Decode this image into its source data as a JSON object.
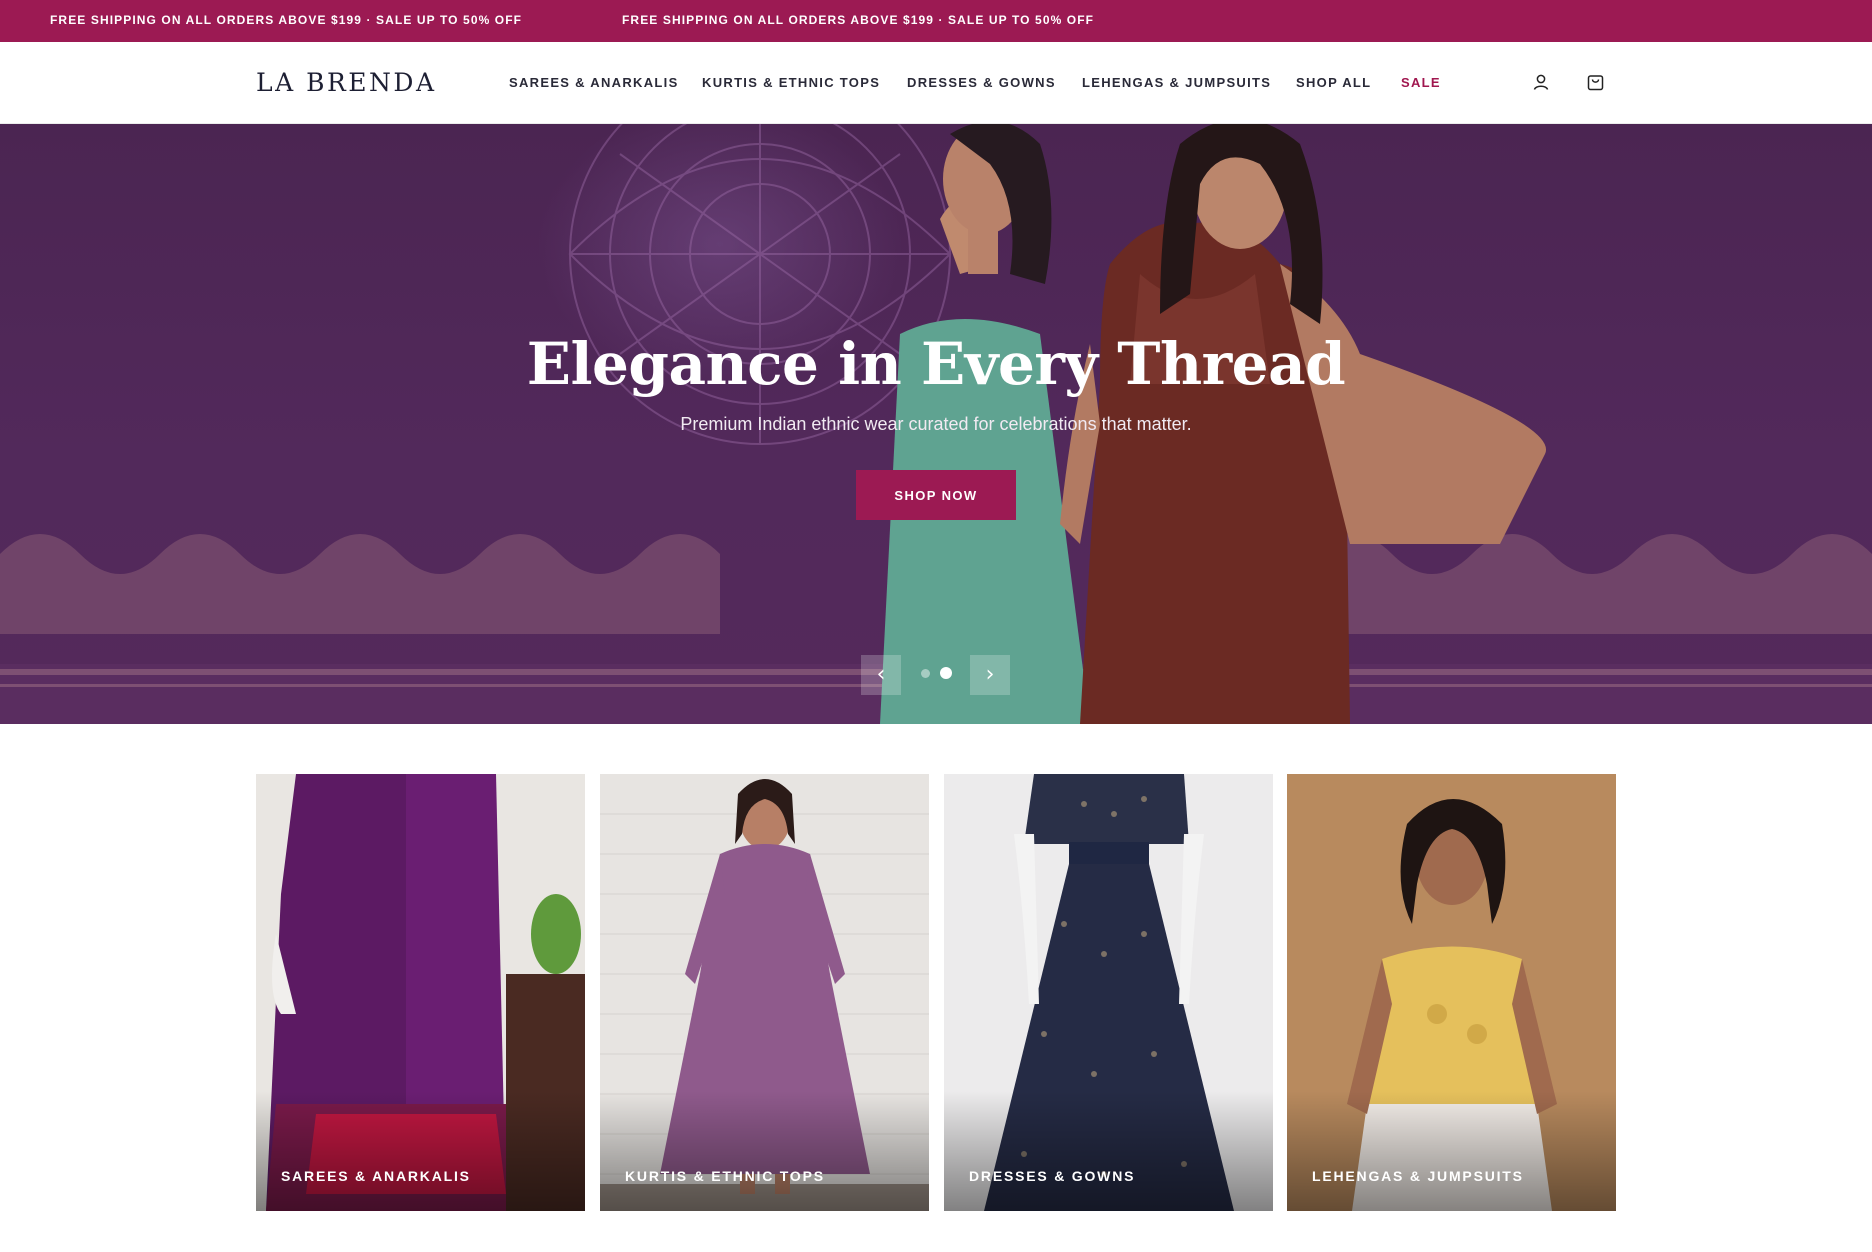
{
  "announcement": {
    "messages": [
      "FREE SHIPPING ON ALL ORDERS ABOVE $199 · SALE UP TO 50% OFF",
      "FREE SHIPPING ON ALL ORDERS ABOVE $199 · SALE UP TO 50% OFF"
    ]
  },
  "header": {
    "logo": "LA BRENDA",
    "nav": [
      "SAREES & ANARKALIS",
      "KURTIS & ETHNIC TOPS",
      "DRESSES & GOWNS",
      "LEHENGAS & JUMPSUITS",
      "SHOP ALL",
      "SALE"
    ],
    "icons": [
      "account-icon",
      "cart-icon"
    ]
  },
  "hero": {
    "title": "Elegance in Every Thread",
    "subtitle": "Premium Indian ethnic wear curated for celebrations that matter.",
    "cta_label": "SHOP NOW",
    "prev_label": "‹",
    "next_label": "›",
    "slide_count": 2,
    "active_slide": 2
  },
  "categories": [
    {
      "label": "SAREES & ANARKALIS"
    },
    {
      "label": "KURTIS & ETHNIC TOPS"
    },
    {
      "label": "DRESSES & GOWNS"
    },
    {
      "label": "LEHENGAS & JUMPSUITS"
    }
  ],
  "colors": {
    "brand": "#9c1a53",
    "hero_bg": "#4f2856",
    "sale": "#a0174f"
  }
}
